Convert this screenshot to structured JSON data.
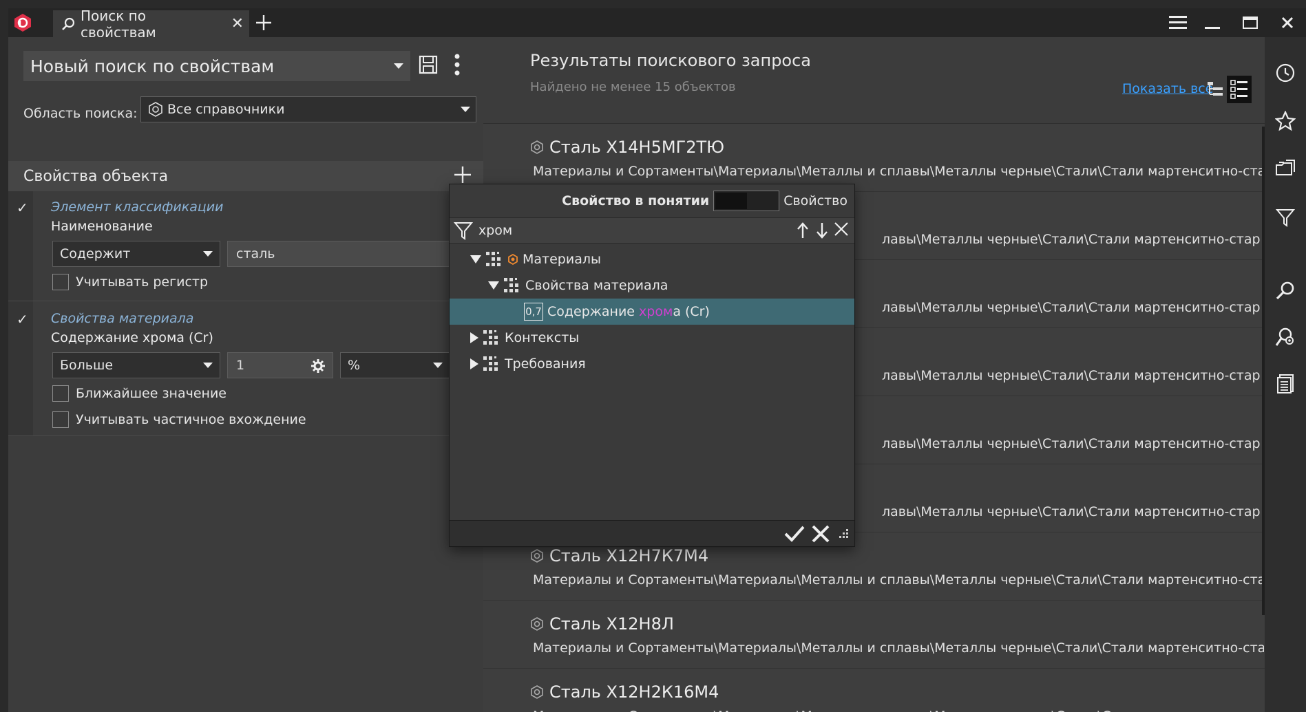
{
  "window": {
    "tab_title": "Поиск по свойствам"
  },
  "search": {
    "title": "Новый поиск по свойствам",
    "scope_label": "Область поиска:",
    "scope_value": "Все справочники",
    "props_header": "Свойства объекта",
    "conditions": [
      {
        "classification": "Элемент классификации",
        "property": "Наименование",
        "operator": "Содержит",
        "value": "сталь",
        "options": [
          "Учитывать регистр"
        ]
      },
      {
        "classification": "Свойства материала",
        "property": "Содержание хрома (Cr)",
        "operator": "Больше",
        "value": "1",
        "unit": "%",
        "options": [
          "Ближайшее значение",
          "Учитывать частичное вхождение"
        ]
      }
    ]
  },
  "results": {
    "title": "Результаты поискового запроса",
    "count": "Найдено не менее 15 объектов",
    "show_all": "Показать все",
    "path": "Материалы и Сортаменты\\Материалы\\Металлы и сплавы\\Металлы черные\\Стали\\Стали мартенситно-стар",
    "path_clipped": "лавы\\Металлы черные\\Стали\\Стали мартенситно-стар",
    "items": [
      {
        "name": "Сталь Х14Н5МГ2ТЮ"
      },
      {
        "name": ""
      },
      {
        "name": ""
      },
      {
        "name": ""
      },
      {
        "name": ""
      },
      {
        "name": ""
      },
      {
        "name": "Сталь Х12Н7К7М4"
      },
      {
        "name": "Сталь Х12Н8Л"
      },
      {
        "name": "Сталь Х12Н2К16М4"
      }
    ]
  },
  "popup": {
    "left_label": "Свойство в понятии",
    "right_label": "Свойство",
    "filter_text": "хром",
    "tree": [
      {
        "label": "Материалы",
        "level": 0,
        "expanded": true
      },
      {
        "label": "Свойства материала",
        "level": 1,
        "expanded": true
      },
      {
        "label_pre": "Содержание ",
        "label_hl": "хром",
        "label_post": "а (Cr)",
        "badge": "0,7",
        "level": 2,
        "selected": true
      },
      {
        "label": "Контексты",
        "level": 0,
        "expanded": false
      },
      {
        "label": "Требования",
        "level": 0,
        "expanded": false
      }
    ]
  },
  "colors": {
    "accent_red": "#e0304a",
    "link": "#3aa0ff",
    "selection": "#3f6a74",
    "highlight": "#d040d0",
    "classification": "#8cb4d8"
  }
}
